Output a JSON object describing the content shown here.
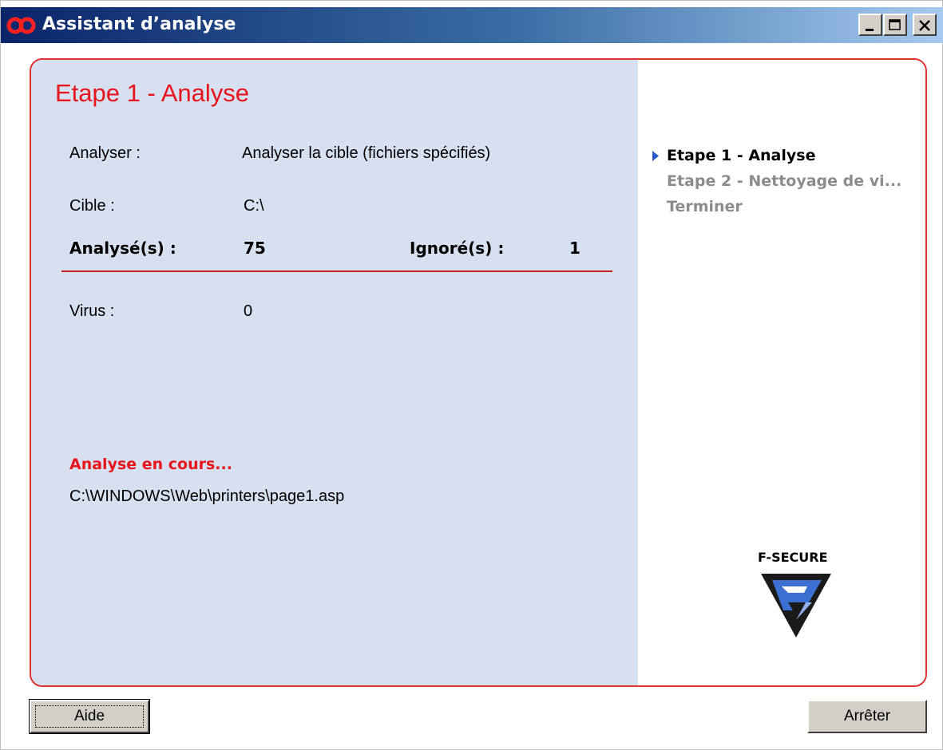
{
  "window": {
    "title": "Assistant d’analyse"
  },
  "step_header": {
    "title": "Etape 1 - Analyse"
  },
  "details": {
    "analyser_label": "Analyser :",
    "analyser_value": "Analyser la cible (fichiers spécifiés)",
    "cible_label": "Cible :",
    "cible_value": "C:\\",
    "analyses_label": "Analysé(s) :",
    "analyses_value": "75",
    "ignores_label": "Ignoré(s) :",
    "ignores_value": "1",
    "virus_label": "Virus :",
    "virus_value": "0"
  },
  "status": {
    "title": "Analyse en cours...",
    "current_file": "C:\\WINDOWS\\Web\\printers\\page1.asp"
  },
  "steps": [
    {
      "label": "Etape 1 - Analyse",
      "state": "active"
    },
    {
      "label": "Etape 2 - Nettoyage de vi...",
      "state": "inactive"
    },
    {
      "label": "Terminer",
      "state": "inactive"
    }
  ],
  "logo": {
    "text": "F-SECURE",
    "icon": "f-secure-logo-icon"
  },
  "buttons": {
    "help_label": "Aide",
    "stop_label": "Arrêter"
  },
  "colors": {
    "accent_red": "#e8141b",
    "panel_blue": "#d6e0f0",
    "titlebar_dark": "#0a246a"
  }
}
